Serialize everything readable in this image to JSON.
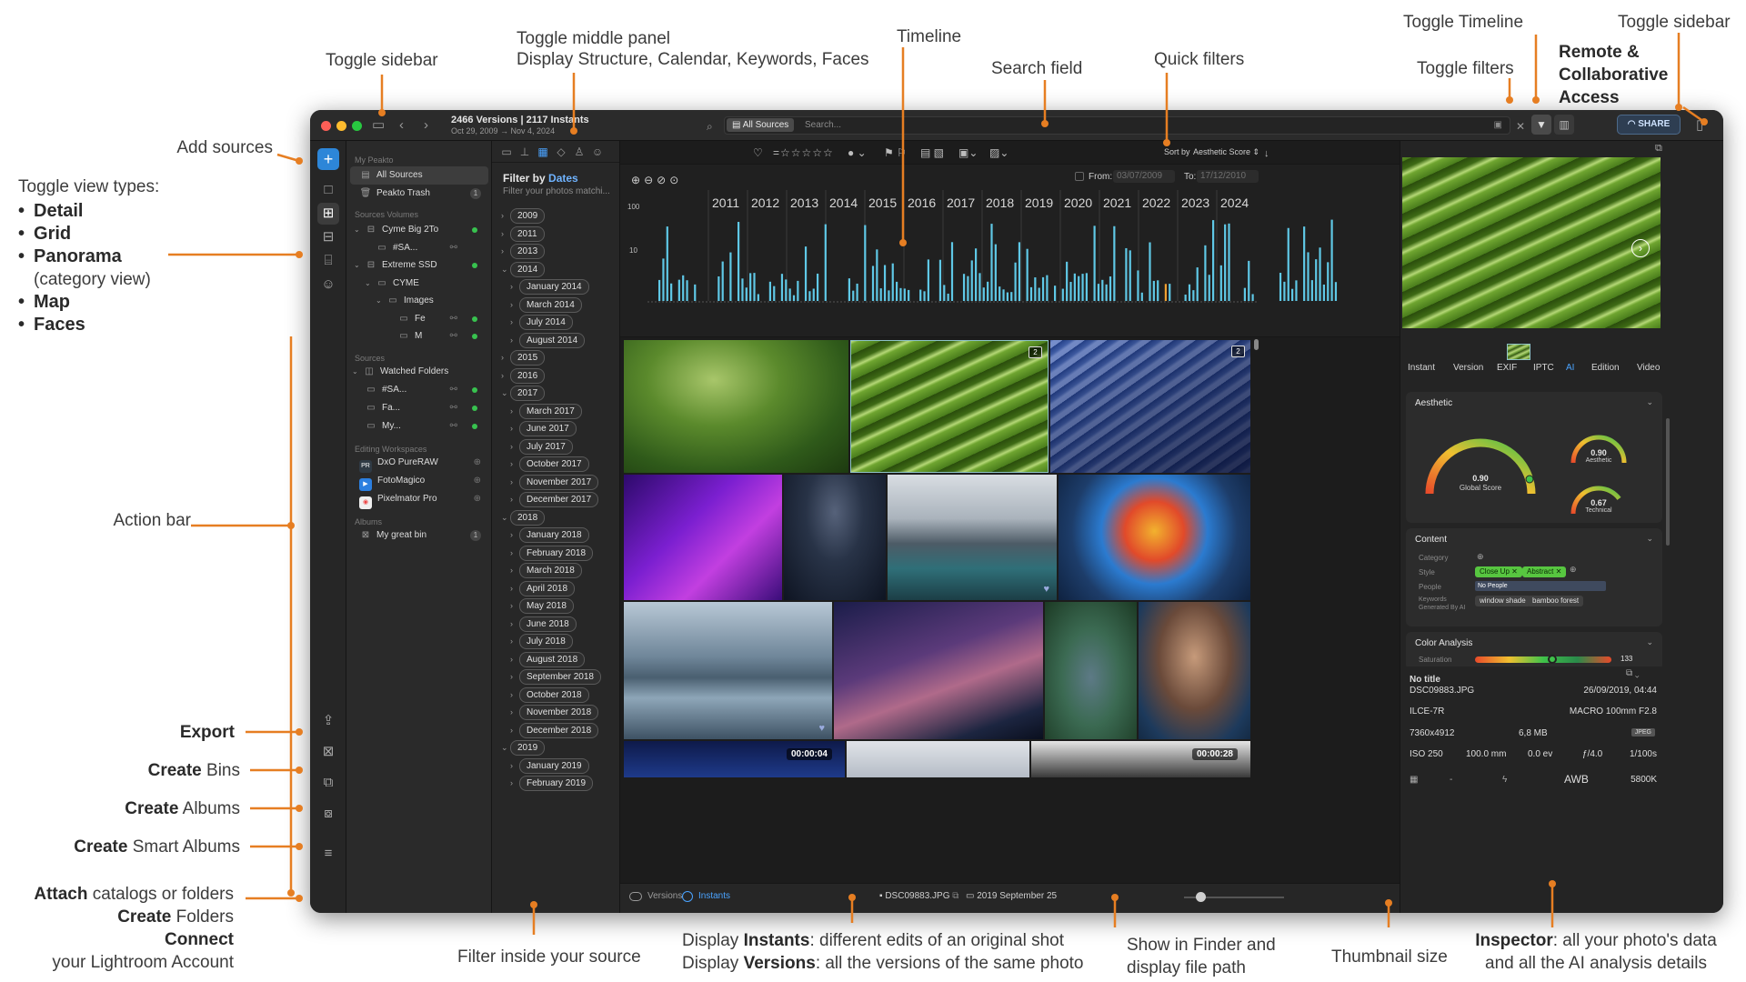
{
  "annotations": {
    "toggle_sidebar_left": "Toggle sidebar",
    "toggle_middle_l1": "Toggle middle panel",
    "toggle_middle_l2": "Display Structure, Calendar, Keywords, Faces",
    "timeline": "Timeline",
    "search_field": "Search field",
    "quick_filters": "Quick filters",
    "toggle_timeline": "Toggle Timeline",
    "toggle_filters": "Toggle filters",
    "remote_access": "Remote & Collaborative Access",
    "toggle_sidebar_right": "Toggle sidebar",
    "add_sources": "Add sources",
    "view_types_title": "Toggle view types:",
    "view_types": [
      "Detail",
      "Grid",
      "Panorama",
      "Map",
      "Faces"
    ],
    "panorama_sub": "(category view)",
    "action_bar": "Action bar",
    "export": "Export",
    "create_bins_b": "Create",
    "create_bins_n": "Bins",
    "create_albums_b": "Create",
    "create_albums_n": "Albums",
    "create_smart_b": "Create",
    "create_smart_n": "Smart Albums",
    "attach_b": "Attach",
    "attach_n": "catalogs or folders",
    "create_folders_b": "Create",
    "create_folders_n": "Folders",
    "connect_b": "Connect",
    "connect_n": "your Lightroom Account",
    "filter_inside": "Filter inside your source",
    "instants_l1_pre": "Display",
    "instants_l1_b": "Instants",
    "instants_l1_post": ": different edits of an original shot",
    "versions_l2_pre": "Display",
    "versions_l2_b": "Versions",
    "versions_l2_post": ": all the versions of the same photo",
    "show_finder_l1": "Show in Finder and",
    "show_finder_l2": "display file path",
    "thumb_size": "Thumbnail size",
    "inspector_b": "Inspector",
    "inspector_l1": ": all your photo's data",
    "inspector_l2": "and all the AI analysis details"
  },
  "titlebar": {
    "title": "2466 Versions | 2117 Instants",
    "date_range": "Oct 29, 2009 → Nov 4, 2024",
    "source_pill": "All Sources",
    "search_placeholder": "Search...",
    "share": "SHARE"
  },
  "sidebar": {
    "my_peakto": "My Peakto",
    "all_sources": "All Sources",
    "peakto_trash": "Peakto Trash",
    "trash_count": "1",
    "sources_volumes": "Sources Volumes",
    "volumes": [
      {
        "label": "Cyme Big 2To",
        "indent": 0
      },
      {
        "label": "#SA...",
        "indent": 1
      },
      {
        "label": "Extreme SSD",
        "indent": 0
      },
      {
        "label": "CYME",
        "indent": 1
      },
      {
        "label": "Images",
        "indent": 2
      },
      {
        "label": "Fe",
        "indent": 3
      },
      {
        "label": "M",
        "indent": 3
      }
    ],
    "sources": "Sources",
    "watched_folders": "Watched Folders",
    "watched": [
      "#SA...",
      "Fa...",
      "My..."
    ],
    "editing_workspaces": "Editing Workspaces",
    "workspaces": [
      "DxO PureRAW",
      "FotoMagico",
      "Pixelmator Pro"
    ],
    "albums": "Albums",
    "album_item": "My great bin",
    "album_count": "1"
  },
  "midpanel": {
    "filter_by": "Filter by",
    "filter_dates": "Dates",
    "filter_sub": "Filter your photos matchi...",
    "entries": [
      {
        "t": "2009",
        "lvl": 0,
        "open": false
      },
      {
        "t": "2011",
        "lvl": 0,
        "open": false
      },
      {
        "t": "2013",
        "lvl": 0,
        "open": false
      },
      {
        "t": "2014",
        "lvl": 0,
        "open": true
      },
      {
        "t": "January 2014",
        "lvl": 1,
        "open": false
      },
      {
        "t": "March 2014",
        "lvl": 1,
        "open": false
      },
      {
        "t": "July 2014",
        "lvl": 1,
        "open": false
      },
      {
        "t": "August 2014",
        "lvl": 1,
        "open": false
      },
      {
        "t": "2015",
        "lvl": 0,
        "open": false
      },
      {
        "t": "2016",
        "lvl": 0,
        "open": false
      },
      {
        "t": "2017",
        "lvl": 0,
        "open": true
      },
      {
        "t": "March 2017",
        "lvl": 1,
        "open": false
      },
      {
        "t": "June 2017",
        "lvl": 1,
        "open": false
      },
      {
        "t": "July 2017",
        "lvl": 1,
        "open": false
      },
      {
        "t": "October 2017",
        "lvl": 1,
        "open": false
      },
      {
        "t": "November 2017",
        "lvl": 1,
        "open": false
      },
      {
        "t": "December 2017",
        "lvl": 1,
        "open": false
      },
      {
        "t": "2018",
        "lvl": 0,
        "open": true
      },
      {
        "t": "January 2018",
        "lvl": 1,
        "open": false
      },
      {
        "t": "February 2018",
        "lvl": 1,
        "open": false
      },
      {
        "t": "March 2018",
        "lvl": 1,
        "open": false
      },
      {
        "t": "April 2018",
        "lvl": 1,
        "open": false
      },
      {
        "t": "May 2018",
        "lvl": 1,
        "open": false
      },
      {
        "t": "June 2018",
        "lvl": 1,
        "open": false
      },
      {
        "t": "July 2018",
        "lvl": 1,
        "open": false
      },
      {
        "t": "August 2018",
        "lvl": 1,
        "open": false
      },
      {
        "t": "September 2018",
        "lvl": 1,
        "open": false
      },
      {
        "t": "October 2018",
        "lvl": 1,
        "open": false
      },
      {
        "t": "November 2018",
        "lvl": 1,
        "open": false
      },
      {
        "t": "December 2018",
        "lvl": 1,
        "open": false
      },
      {
        "t": "2019",
        "lvl": 0,
        "open": true
      },
      {
        "t": "January 2019",
        "lvl": 1,
        "open": false
      },
      {
        "t": "February 2019",
        "lvl": 1,
        "open": false
      }
    ]
  },
  "quickbar": {
    "sort_by": "Sort by",
    "sort_value": "Aesthetic Score"
  },
  "timeline": {
    "from_label": "From:",
    "from_value": "03/07/2009",
    "to_label": "To:",
    "to_value": "17/12/2010",
    "years": [
      "2011",
      "2012",
      "2013",
      "2014",
      "2015",
      "2016",
      "2017",
      "2018",
      "2019",
      "2020",
      "2021",
      "2022",
      "2023",
      "2024"
    ],
    "scale_100": "100",
    "scale_10": "10",
    "bar_color": "#5fc8e6",
    "highlight_color": "#f0a030"
  },
  "grid": {
    "badge_count": "2",
    "video1": "00:00:04",
    "video2": "00:00:28"
  },
  "bottombar": {
    "versions": "Versions",
    "instants": "Instants",
    "filename": "DSC09883.JPG",
    "folder": "2019 September 25"
  },
  "inspector": {
    "tabs": [
      "Instant",
      "Version",
      "EXIF",
      "IPTC",
      "AI",
      "Edition",
      "Video"
    ],
    "active_tab": "AI",
    "aesthetic": "Aesthetic",
    "global_value": "0.90",
    "global_label": "Global Score",
    "aesthetic_value": "0.90",
    "aesthetic_label": "Aesthetic",
    "technical_value": "0.67",
    "technical_label": "Technical",
    "content": "Content",
    "category": "Category",
    "style": "Style",
    "style_tags": [
      "Close Up",
      "Abstract"
    ],
    "people": "People",
    "no_people": "No People",
    "keywords_generated": "Keywords Generated By AI",
    "keywords": [
      "window shade",
      "bamboo forest"
    ],
    "color_analysis": "Color Analysis",
    "saturation": "Saturation",
    "saturation_value": "133",
    "no_title": "No title",
    "file": "DSC09883.JPG",
    "datetime": "26/09/2019, 04:44",
    "camera": "ILCE-7R",
    "lens": "MACRO 100mm F2.8",
    "dims": "7360x4912",
    "size": "6,8 MB",
    "format": "JPEG",
    "iso": "ISO 250",
    "focal": "100.0 mm",
    "ev": "0.0 ev",
    "aperture": "ƒ/4.0",
    "shutter": "1/100s",
    "wb": "AWB",
    "temp": "5800K"
  }
}
